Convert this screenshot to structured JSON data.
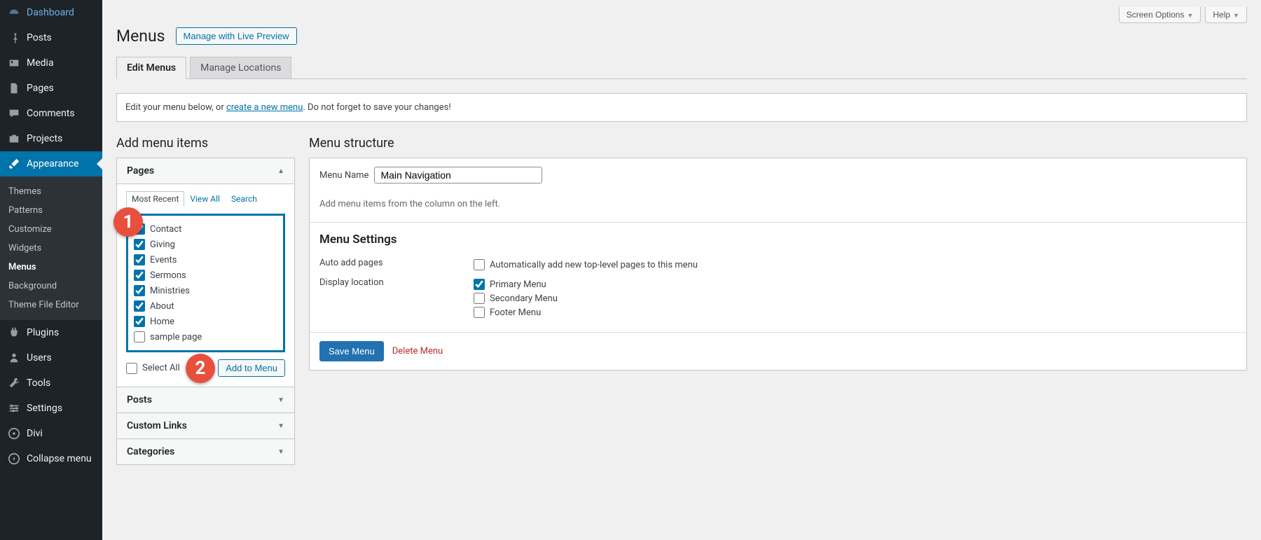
{
  "sidebar": {
    "items": [
      {
        "icon": "dashboard",
        "label": "Dashboard"
      },
      {
        "icon": "pin",
        "label": "Posts"
      },
      {
        "icon": "media",
        "label": "Media"
      },
      {
        "icon": "page",
        "label": "Pages"
      },
      {
        "icon": "comment",
        "label": "Comments"
      },
      {
        "icon": "portfolio",
        "label": "Projects"
      },
      {
        "icon": "brush",
        "label": "Appearance",
        "current": true,
        "children": [
          {
            "label": "Themes"
          },
          {
            "label": "Patterns"
          },
          {
            "label": "Customize"
          },
          {
            "label": "Widgets"
          },
          {
            "label": "Menus",
            "current": true
          },
          {
            "label": "Background"
          },
          {
            "label": "Theme File Editor"
          }
        ]
      },
      {
        "icon": "plugin",
        "label": "Plugins"
      },
      {
        "icon": "user",
        "label": "Users"
      },
      {
        "icon": "wrench",
        "label": "Tools"
      },
      {
        "icon": "sliders",
        "label": "Settings"
      },
      {
        "icon": "divi",
        "label": "Divi"
      },
      {
        "icon": "collapse",
        "label": "Collapse menu"
      }
    ]
  },
  "topbar": {
    "screen_options": "Screen Options",
    "help": "Help"
  },
  "heading": {
    "title": "Menus",
    "preview": "Manage with Live Preview"
  },
  "tabs": {
    "edit": "Edit Menus",
    "locations": "Manage Locations"
  },
  "notice": {
    "pre": "Edit your menu below, or ",
    "link": "create a new menu",
    "post": ". Do not forget to save your changes!"
  },
  "add": {
    "title": "Add menu items",
    "panels": {
      "pages": "Pages",
      "posts": "Posts",
      "custom": "Custom Links",
      "categories": "Categories"
    },
    "subtabs": {
      "recent": "Most Recent",
      "all": "View All",
      "search": "Search"
    },
    "pages_list": [
      {
        "label": "Contact",
        "checked": true
      },
      {
        "label": "Giving",
        "checked": true
      },
      {
        "label": "Events",
        "checked": true
      },
      {
        "label": "Sermons",
        "checked": true
      },
      {
        "label": "Ministries",
        "checked": true
      },
      {
        "label": "About",
        "checked": true
      },
      {
        "label": "Home",
        "checked": true
      },
      {
        "label": "sample page",
        "checked": false
      }
    ],
    "select_all": "Select All",
    "add_button": "Add to Menu"
  },
  "structure": {
    "title": "Menu structure",
    "name_label": "Menu Name",
    "name_value": "Main Navigation",
    "placeholder": "Add menu items from the column on the left.",
    "settings_title": "Menu Settings",
    "auto_label": "Auto add pages",
    "auto_option": "Automatically add new top-level pages to this menu",
    "location_label": "Display location",
    "locations": [
      {
        "label": "Primary Menu",
        "checked": true
      },
      {
        "label": "Secondary Menu",
        "checked": false
      },
      {
        "label": "Footer Menu",
        "checked": false
      }
    ],
    "save": "Save Menu",
    "delete": "Delete Menu"
  },
  "callouts": {
    "one": "1",
    "two": "2"
  }
}
